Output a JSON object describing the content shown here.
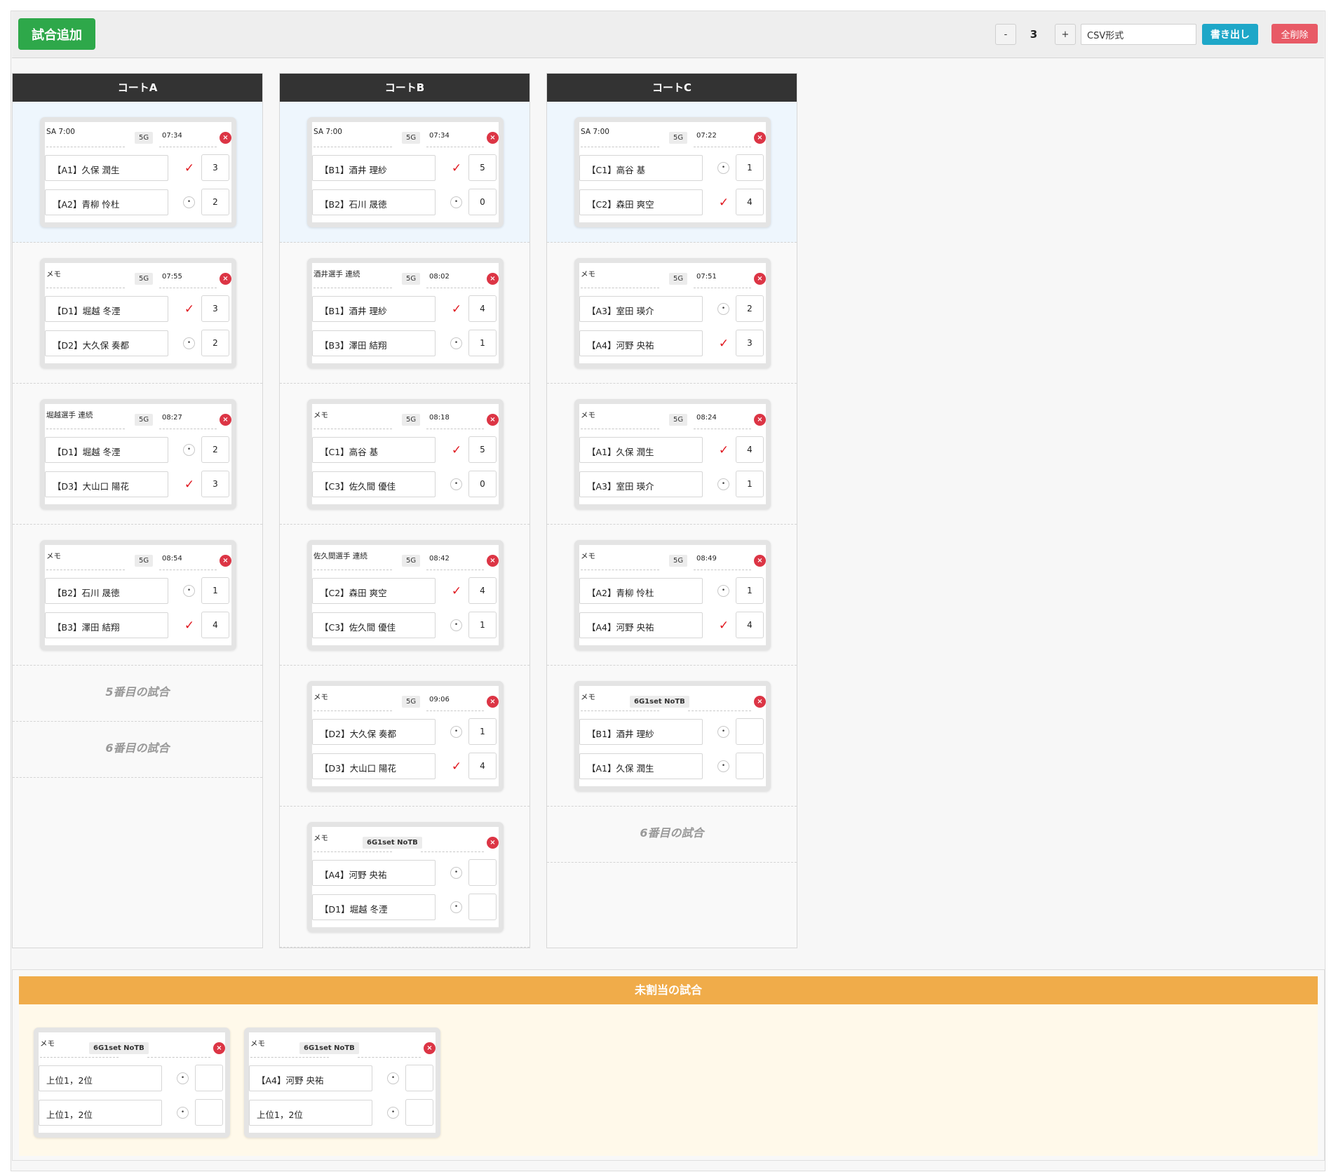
{
  "toolbar": {
    "add_label": "試合追加",
    "minus_label": "-",
    "court_count": "3",
    "plus_label": "+",
    "format_value": "CSV形式",
    "export_label": "書き出し",
    "delete_all_label": "全削除"
  },
  "courts": [
    {
      "name": "コートA",
      "matches": [
        {
          "memo": "SA 7:00",
          "format": "5G",
          "time": "07:34",
          "p1": "【A1】久保 潤生",
          "p1_win": true,
          "s1": "3",
          "p2": "【A2】青柳 怜杜",
          "p2_win": false,
          "s2": "2"
        },
        {
          "memo": "メモ",
          "format": "5G",
          "time": "07:55",
          "p1": "【D1】堀越 冬湮",
          "p1_win": true,
          "s1": "3",
          "p2": "【D2】大久保 奏都",
          "p2_win": false,
          "s2": "2"
        },
        {
          "memo": "堀越選手 連続",
          "format": "5G",
          "time": "08:27",
          "p1": "【D1】堀越 冬湮",
          "p1_win": false,
          "s1": "2",
          "p2": "【D3】大山口 陽花",
          "p2_win": true,
          "s2": "3"
        },
        {
          "memo": "メモ",
          "format": "5G",
          "time": "08:54",
          "p1": "【B2】石川 晟徳",
          "p1_win": false,
          "s1": "1",
          "p2": "【B3】澤田 結翔",
          "p2_win": true,
          "s2": "4"
        }
      ],
      "empty_slots": [
        "5番目の試合",
        "6番目の試合"
      ]
    },
    {
      "name": "コートB",
      "matches": [
        {
          "memo": "SA 7:00",
          "format": "5G",
          "time": "07:34",
          "p1": "【B1】酒井 理紗",
          "p1_win": true,
          "s1": "5",
          "p2": "【B2】石川 晟徳",
          "p2_win": false,
          "s2": "0"
        },
        {
          "memo": "酒井選手 連続",
          "format": "5G",
          "time": "08:02",
          "p1": "【B1】酒井 理紗",
          "p1_win": true,
          "s1": "4",
          "p2": "【B3】澤田 結翔",
          "p2_win": false,
          "s2": "1"
        },
        {
          "memo": "メモ",
          "format": "5G",
          "time": "08:18",
          "p1": "【C1】高谷 基",
          "p1_win": true,
          "s1": "5",
          "p2": "【C3】佐久間 優佳",
          "p2_win": false,
          "s2": "0"
        },
        {
          "memo": "佐久間選手 連続",
          "format": "5G",
          "time": "08:42",
          "p1": "【C2】森田 爽空",
          "p1_win": true,
          "s1": "4",
          "p2": "【C3】佐久間 優佳",
          "p2_win": false,
          "s2": "1"
        },
        {
          "memo": "メモ",
          "format": "5G",
          "time": "09:06",
          "p1": "【D2】大久保 奏都",
          "p1_win": false,
          "s1": "1",
          "p2": "【D3】大山口 陽花",
          "p2_win": true,
          "s2": "4"
        },
        {
          "memo": "メモ",
          "format": "6G1set NoTB",
          "time": "",
          "p1": "【A4】河野 央祐",
          "p1_win": false,
          "s1": "",
          "p2": "【D1】堀越 冬湮",
          "p2_win": false,
          "s2": ""
        }
      ],
      "empty_slots": []
    },
    {
      "name": "コートC",
      "matches": [
        {
          "memo": "SA 7:00",
          "format": "5G",
          "time": "07:22",
          "p1": "【C1】高谷 基",
          "p1_win": false,
          "s1": "1",
          "p2": "【C2】森田 爽空",
          "p2_win": true,
          "s2": "4"
        },
        {
          "memo": "メモ",
          "format": "5G",
          "time": "07:51",
          "p1": "【A3】室田 瑛介",
          "p1_win": false,
          "s1": "2",
          "p2": "【A4】河野 央祐",
          "p2_win": true,
          "s2": "3"
        },
        {
          "memo": "メモ",
          "format": "5G",
          "time": "08:24",
          "p1": "【A1】久保 潤生",
          "p1_win": true,
          "s1": "4",
          "p2": "【A3】室田 瑛介",
          "p2_win": false,
          "s2": "1"
        },
        {
          "memo": "メモ",
          "format": "5G",
          "time": "08:49",
          "p1": "【A2】青柳 怜杜",
          "p1_win": false,
          "s1": "1",
          "p2": "【A4】河野 央祐",
          "p2_win": true,
          "s2": "4"
        },
        {
          "memo": "メモ",
          "format": "6G1set NoTB",
          "time": "",
          "p1": "【B1】酒井 理紗",
          "p1_win": false,
          "s1": "",
          "p2": "【A1】久保 潤生",
          "p2_win": false,
          "s2": ""
        }
      ],
      "empty_slots": [
        "6番目の試合"
      ]
    }
  ],
  "unassigned": {
    "title": "未割当の試合",
    "matches": [
      {
        "memo": "メモ",
        "format": "6G1set NoTB",
        "time": "",
        "p1": "上位1，2位",
        "p1_win": false,
        "s1": "",
        "p2": "上位1，2位",
        "p2_win": false,
        "s2": ""
      },
      {
        "memo": "メモ",
        "format": "6G1set NoTB",
        "time": "",
        "p1": "【A4】河野 央祐",
        "p1_win": false,
        "s1": "",
        "p2": "上位1，2位",
        "p2_win": false,
        "s2": ""
      }
    ]
  },
  "icons": {
    "delete": "close-icon",
    "win": "check-icon",
    "not_win": "radio-dot-icon"
  },
  "colors": {
    "add": "#2ea84a",
    "export": "#1ea7c8",
    "delete_all": "#e85a66",
    "court_header": "#333333",
    "unassigned_header": "#f0ac4a",
    "win_check": "#e0161e",
    "delete_icon": "#dc3545"
  }
}
